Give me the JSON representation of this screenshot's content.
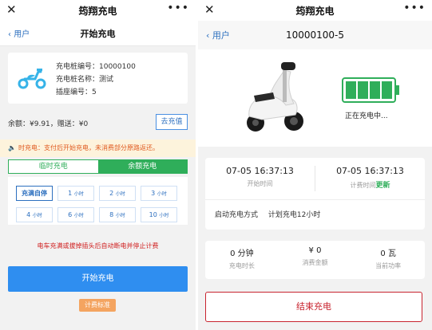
{
  "app_name": "筠翔充电",
  "left": {
    "nav": {
      "back": "用户",
      "title": "开始充电"
    },
    "info": {
      "pile_no": "充电桩编号：10000100",
      "pile_name": "充电桩名称：测试",
      "socket_no": "插座编号：5"
    },
    "balance": "余额：¥9.91，赠送：¥0",
    "recharge_button": "去充值",
    "notice": "时充电：支付后开始充电，未消费部分原路返还。",
    "tabs": [
      "临时充电",
      "余额充电"
    ],
    "active_tab": "余额充电",
    "options": [
      {
        "value": "充满自停",
        "unit": ""
      },
      {
        "value": "1",
        "unit": "小时"
      },
      {
        "value": "2",
        "unit": "小时"
      },
      {
        "value": "3",
        "unit": "小时"
      },
      {
        "value": "4",
        "unit": "小时"
      },
      {
        "value": "6",
        "unit": "小时"
      },
      {
        "value": "8",
        "unit": "小时"
      },
      {
        "value": "10",
        "unit": "小时"
      }
    ],
    "selected_option": "充满自停",
    "warning": "电车充满或拔掉插头后自动断电并停止计费",
    "start_button": "开始充电",
    "tariff_button": "计费标准"
  },
  "right": {
    "nav": {
      "back": "用户",
      "title": "10000100-5"
    },
    "charging_status": "正在充电中...",
    "battery_level": 1.0,
    "start_time": "07-05 16:37:13",
    "start_time_label": "开始时间",
    "bill_time": "07-05 16:37:13",
    "bill_time_label": "计费时间",
    "bill_update": "更新",
    "mode_label": "启动充电方式",
    "mode_value": "计划充电12小时",
    "stats": [
      {
        "value": "0 分钟",
        "label": "充电时长"
      },
      {
        "value": "¥ 0",
        "label": "消费金额"
      },
      {
        "value": "0 瓦",
        "label": "当前功率"
      }
    ],
    "end_button": "结束充电"
  },
  "colors": {
    "accent_blue": "#2f8ef0",
    "green": "#2fae5a",
    "danger_red": "#c8242f",
    "notice_bg": "#fdf3dc",
    "notice_text": "#e05a1f",
    "tariff_orange": "#f4a460"
  },
  "icons": [
    "close-icon",
    "more-icon",
    "back-chevron-icon",
    "scooter-icon",
    "speaker-icon",
    "battery-icon",
    "scooter-photo"
  ]
}
